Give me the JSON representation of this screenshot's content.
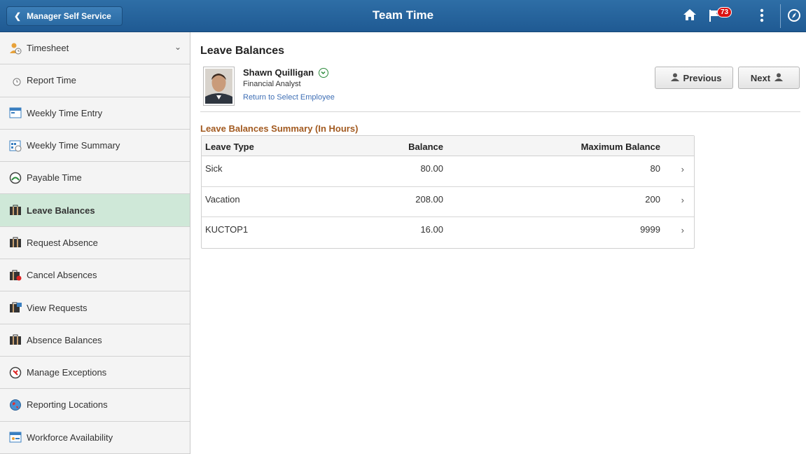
{
  "header": {
    "back_label": "Manager Self Service",
    "title": "Team Time",
    "notification_count": "73",
    "icons": [
      "home-icon",
      "flag-icon",
      "kebab-menu-icon",
      "navbar-compass-icon"
    ],
    "bg_color": "#1f5a93"
  },
  "sidebar": {
    "items": [
      {
        "label": "Timesheet",
        "icon": "timesheet-icon"
      },
      {
        "label": "Report Time",
        "icon": "report-time-icon"
      },
      {
        "label": "Weekly Time Entry",
        "icon": "weekly-entry-icon"
      },
      {
        "label": "Weekly Time Summary",
        "icon": "weekly-summary-icon"
      },
      {
        "label": "Payable Time",
        "icon": "payable-time-icon"
      },
      {
        "label": "Leave Balances",
        "icon": "briefcase-icon"
      },
      {
        "label": "Request Absence",
        "icon": "briefcase-icon"
      },
      {
        "label": "Cancel Absences",
        "icon": "briefcase-cancel-icon"
      },
      {
        "label": "View Requests",
        "icon": "briefcase-view-icon"
      },
      {
        "label": "Absence Balances",
        "icon": "briefcase-icon"
      },
      {
        "label": "Manage Exceptions",
        "icon": "exceptions-icon"
      },
      {
        "label": "Reporting Locations",
        "icon": "globe-icon"
      },
      {
        "label": "Workforce Availability",
        "icon": "workforce-icon"
      }
    ],
    "active_color": "#cfe8d8"
  },
  "main": {
    "page_title": "Leave Balances",
    "employee": {
      "name": "Shawn Quilligan",
      "job_title": "Financial Analyst",
      "return_link": "Return to Select Employee"
    },
    "prev_label": "Previous",
    "next_label": "Next",
    "summary_title": "Leave Balances Summary (In Hours)",
    "summary_color": "#a25a20",
    "table": {
      "headers": [
        "Leave Type",
        "Balance",
        "Maximum Balance"
      ],
      "rows": [
        {
          "type": "Sick",
          "balance": "80.00",
          "max": "80"
        },
        {
          "type": "Vacation",
          "balance": "208.00",
          "max": "200"
        },
        {
          "type": "KUCTOP1",
          "balance": "16.00",
          "max": "9999"
        }
      ]
    }
  }
}
